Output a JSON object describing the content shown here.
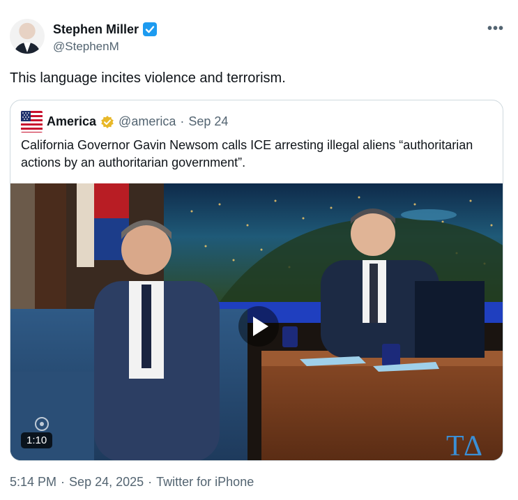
{
  "tweet": {
    "author_name": "Stephen Miller",
    "author_handle": "@StephenM",
    "text": "This language incites violence and terrorism.",
    "more_label": "•••",
    "time": "5:14 PM",
    "date": "Sep 24, 2025",
    "separator": "·",
    "source": "Twitter for iPhone",
    "verified_color": "#1d9bf0"
  },
  "quote": {
    "author_name": "America",
    "author_handle": "@america",
    "separator": "·",
    "date": "Sep 24",
    "text": "California Governor Gavin Newsom calls ICE arresting illegal aliens “authoritarian actions by an authoritarian government”.",
    "verified_color": "#e8b829",
    "avatar_icon": "us-flag-icon",
    "video": {
      "duration": "1:10",
      "play_icon": "play-icon",
      "desk_logo_text": "T A"
    }
  }
}
